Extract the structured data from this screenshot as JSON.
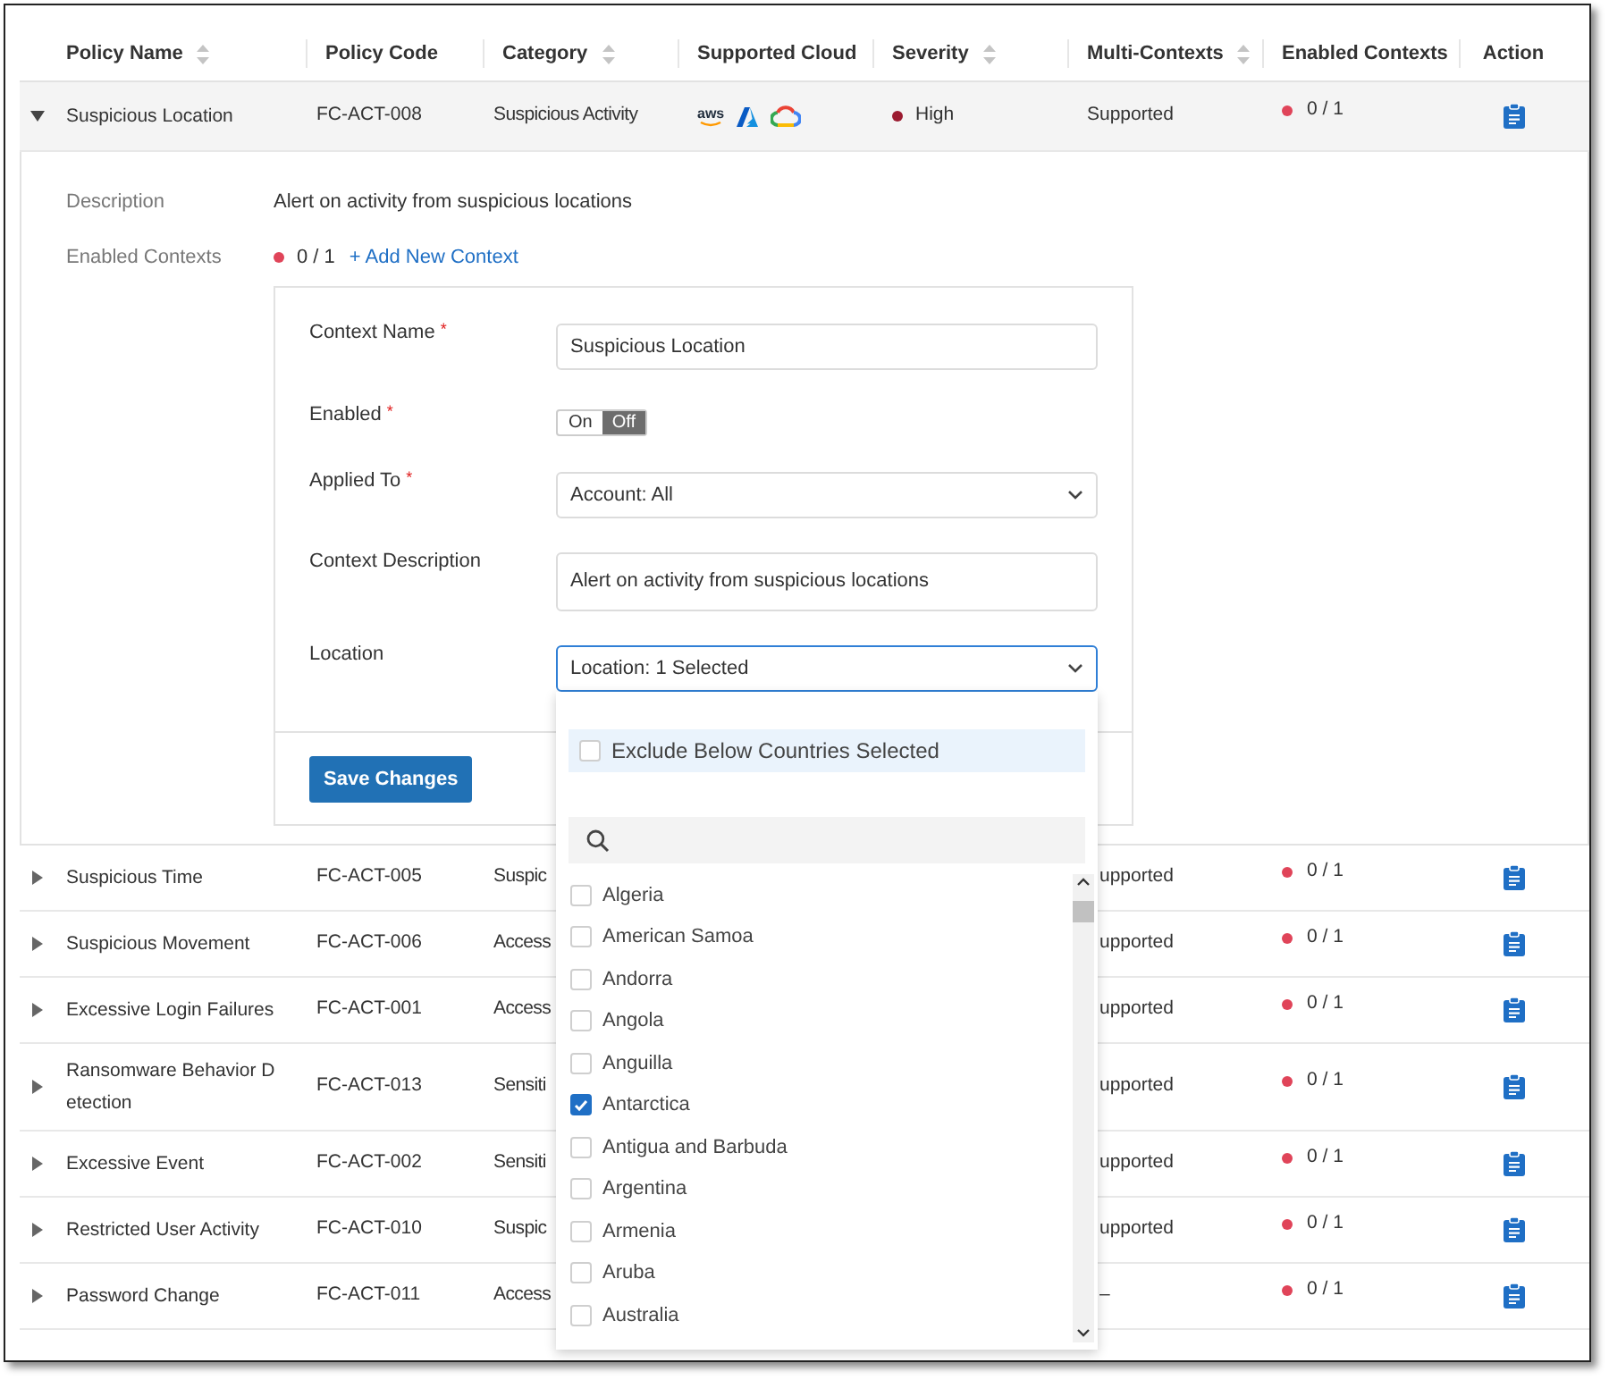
{
  "table": {
    "columns": [
      {
        "label": "Policy Name",
        "sortable": true
      },
      {
        "label": "Policy Code",
        "sortable": false
      },
      {
        "label": "Category",
        "sortable": true
      },
      {
        "label": "Supported Cloud",
        "sortable": false
      },
      {
        "label": "Severity",
        "sortable": true
      },
      {
        "label": "Multi-Contexts",
        "sortable": true
      },
      {
        "label": "Enabled Contexts",
        "sortable": false
      },
      {
        "label": "Action",
        "sortable": false
      }
    ],
    "rows": [
      {
        "expanded": true,
        "name": "Suspicious Location",
        "code": "FC-ACT-008",
        "category": "Suspicious Activity",
        "clouds": [
          {
            "kind": "aws",
            "label": "aws"
          },
          {
            "kind": "azure"
          },
          {
            "kind": "gcp"
          }
        ],
        "severity": "High",
        "multi": "Supported",
        "enabled": "0 / 1"
      },
      {
        "expanded": false,
        "name": "Suspicious Time",
        "code": "FC-ACT-005",
        "category": "Suspic",
        "multi": "upported",
        "enabled": "0 / 1"
      },
      {
        "expanded": false,
        "name": "Suspicious Movement",
        "code": "FC-ACT-006",
        "category": "Access",
        "multi": "upported",
        "enabled": "0 / 1"
      },
      {
        "expanded": false,
        "name": "Excessive Login Failures",
        "code": "FC-ACT-001",
        "category": "Access",
        "multi": "upported",
        "enabled": "0 / 1"
      },
      {
        "expanded": false,
        "name": "Ransomware Behavior D etection",
        "code": "FC-ACT-013",
        "category": "Sensiti",
        "multi": "upported",
        "enabled": "0 / 1"
      },
      {
        "expanded": false,
        "name": "Excessive Event",
        "code": "FC-ACT-002",
        "category": "Sensiti",
        "multi": "upported",
        "enabled": "0 / 1"
      },
      {
        "expanded": false,
        "name": "Restricted User Activity",
        "code": "FC-ACT-010",
        "category": "Suspic",
        "multi": "upported",
        "enabled": "0 / 1"
      },
      {
        "expanded": false,
        "name": "Password Change",
        "code": "FC-ACT-011",
        "category": "Access",
        "multi": "–",
        "enabled": "0 / 1"
      }
    ]
  },
  "detail": {
    "description_label": "Description",
    "description": "Alert on activity from suspicious locations",
    "contexts_label": "Enabled Contexts",
    "contexts_count": "0 / 1",
    "add_context": "+ Add New Context",
    "form": {
      "fields": [
        {
          "kind": "text",
          "label": "Context Name",
          "required_mark": "*",
          "value": "Suspicious Location"
        },
        {
          "kind": "toggle",
          "label": "Enabled",
          "required_mark": "*",
          "on_label": "On",
          "off_label": "Off",
          "on": false
        },
        {
          "kind": "select",
          "label": "Applied To",
          "required_mark": "*",
          "value": "Account: All",
          "focused": false
        },
        {
          "kind": "text",
          "label": "Context Description",
          "value": "Alert on activity from suspicious locations"
        },
        {
          "kind": "select",
          "label": "Location",
          "value": "Location: 1 Selected",
          "focused": true
        }
      ],
      "save_button": "Save Changes"
    },
    "location_dropdown": {
      "exclude": {
        "label": "Exclude Below Countries Selected",
        "checked": false
      },
      "options": [
        {
          "label": "Algeria",
          "checked": false
        },
        {
          "label": "American Samoa",
          "checked": false
        },
        {
          "label": "Andorra",
          "checked": false
        },
        {
          "label": "Angola",
          "checked": false
        },
        {
          "label": "Anguilla",
          "checked": false
        },
        {
          "label": "Antarctica",
          "checked": true
        },
        {
          "label": "Antigua and Barbuda",
          "checked": false
        },
        {
          "label": "Argentina",
          "checked": false
        },
        {
          "label": "Armenia",
          "checked": false
        },
        {
          "label": "Aruba",
          "checked": false
        },
        {
          "label": "Australia",
          "checked": false
        }
      ]
    }
  }
}
